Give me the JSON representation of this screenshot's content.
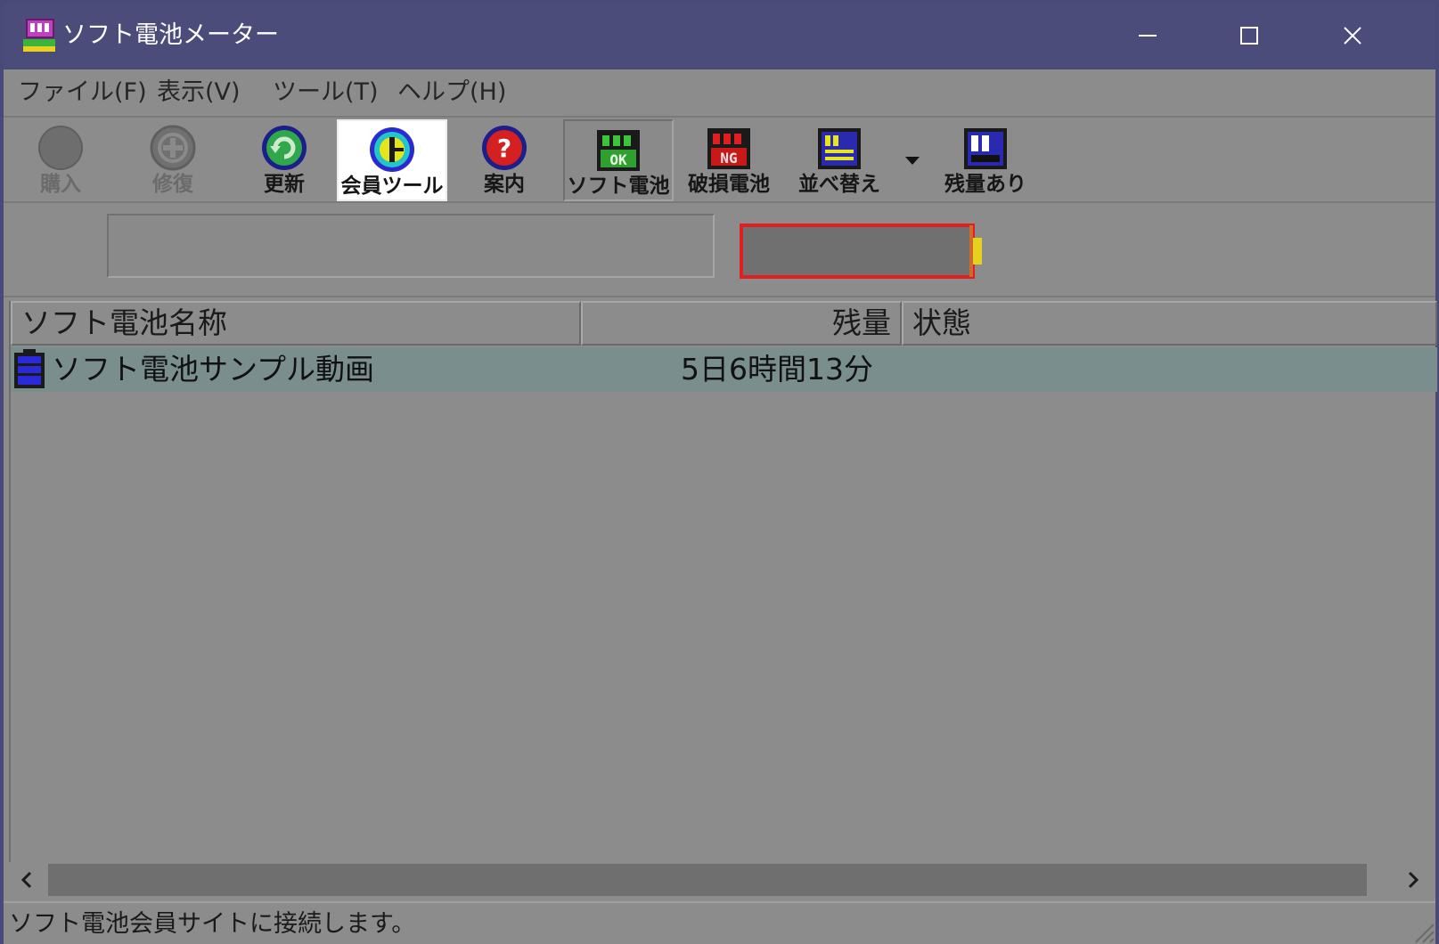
{
  "window": {
    "title": "ソフト電池メーター",
    "app_icon": "battery-meter-app-icon",
    "controls": {
      "minimize_icon": "minimize-icon",
      "maximize_icon": "maximize-icon",
      "close_icon": "close-icon"
    }
  },
  "menu": [
    {
      "label": "ファイル(F)"
    },
    {
      "label": "表示(V)"
    },
    {
      "label": "ツール(T)"
    },
    {
      "label": "ヘルプ(H)"
    }
  ],
  "toolbar": {
    "buttons": [
      {
        "label": "購入",
        "icon": "purchase-icon",
        "state": "disabled"
      },
      {
        "label": "修復",
        "icon": "repair-icon",
        "state": "disabled"
      },
      {
        "label": "更新",
        "icon": "refresh-icon",
        "state": "enabled"
      },
      {
        "label": "会員ツール",
        "icon": "member-tool-icon",
        "state": "hover"
      },
      {
        "label": "案内",
        "icon": "help-icon",
        "state": "enabled"
      },
      {
        "label": "ソフト電池",
        "icon": "soft-battery-ok-icon",
        "state": "pressed",
        "icon_text": "OK"
      },
      {
        "label": "破損電池",
        "icon": "damaged-battery-ng-icon",
        "state": "enabled",
        "icon_text": "NG"
      },
      {
        "label": "並べ替え",
        "icon": "sort-icon",
        "state": "enabled"
      },
      {
        "label": "残量あり",
        "icon": "remaining-icon",
        "state": "enabled"
      }
    ],
    "sort_dropdown_icon": "dropdown-arrow-icon"
  },
  "info_panel": {
    "name_box_value": "",
    "battery_level": 0
  },
  "table": {
    "columns": [
      "ソフト電池名称",
      "残量",
      "状態"
    ],
    "rows": [
      {
        "icon": "battery-row-icon",
        "name": "ソフト電池サンプル動画",
        "remaining": "5日6時間13分",
        "state": ""
      }
    ]
  },
  "statusbar": {
    "text": "ソフト電池会員サイトに接続します。"
  },
  "colors": {
    "titlebar": "#4c4c7a",
    "background": "#8c8c8c",
    "selected_row": "#7b8e8e",
    "battery_border": "#e02020",
    "battery_tip": "#e6d21e"
  }
}
